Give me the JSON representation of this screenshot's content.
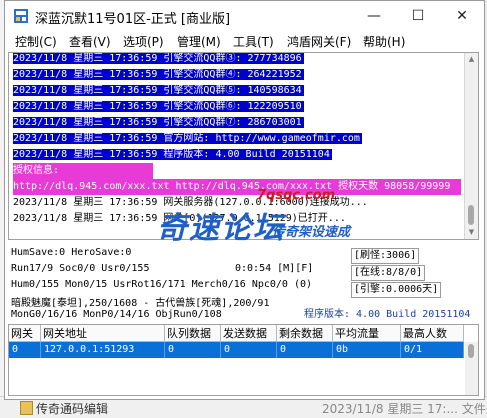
{
  "window": {
    "title": "深蓝沉默11号01区-正式 [商业版]",
    "minimize": "—",
    "maximize": "☐",
    "close": "✕"
  },
  "menu": [
    {
      "label": "控制(C)"
    },
    {
      "label": "查看(V)"
    },
    {
      "label": "选项(P)"
    },
    {
      "label": "管理(M)"
    },
    {
      "label": "工具(T)"
    },
    {
      "label": "鸿盾网关(F)"
    },
    {
      "label": "帮助(H)"
    }
  ],
  "log": {
    "selected_lines": [
      "2023/11/8 星期三 17:36:59 引擎交流QQ群③: 277734896",
      "2023/11/8 星期三 17:36:59 引擎交流QQ群④: 264221952",
      "2023/11/8 星期三 17:36:59 引擎交流QQ群⑤: 140598634",
      "2023/11/8 星期三 17:36:59 引擎交流QQ群⑥: 122209510",
      "2023/11/8 星期三 17:36:59 引擎交流QQ群⑦: 286703001",
      "2023/11/8 星期三 17:36:59 官方网站: http://www.gameofmir.com",
      "2023/11/8 星期三 17:36:59 程序版本: 4.00 Build 20151104"
    ],
    "auth_label": "授权信息:",
    "auth_line": "http://dlq.945.com/xxx.txt http://dlq.945.com/xxx.txt 授权天数 98058/99999",
    "normal_lines": [
      "2023/11/8 星期三 17:36:59 网关服务器(127.0.0.1:6000)连接成功...",
      "2023/11/8 星期三 17:36:59 网关[0](127.0.0.1:5129)已打开..."
    ]
  },
  "watermark": {
    "main": "奇速论坛",
    "url": "7qsqc.com",
    "sub": "传奇架设速成"
  },
  "status": {
    "line1": "HumSave:0 HeroSave:0",
    "line2": "Run17/9 Soc0/0 Usr0/155",
    "timer": "0:0:54 [M][F]",
    "line3": "Hum0/155 Mon0/15 UsrRot16/171 Merch0/16 Npc0/0 (0)",
    "line4": "暗殿魅魔[泰坦],250/1608 - 古代兽族[死魂],200/91",
    "line5": "MonG0/16/16 MonP0/14/16 ObjRun0/108",
    "refresh": "[刷怪:3006]",
    "online": "[在线:8/8/0]",
    "engine": "[引擎:0.0006天]",
    "version": "程序版本: 4.00 Build 20151104"
  },
  "gateway_table": {
    "headers": [
      "网关",
      "网关地址",
      "队列数据",
      "发送数据",
      "剩余数据",
      "平均流量",
      "最高人数"
    ],
    "rows": [
      [
        "0",
        "127.0.0.1:51293",
        "0",
        "0",
        "0",
        "0b",
        "0/1"
      ]
    ]
  },
  "background": {
    "taskbar_item": "传奇通码编辑",
    "taskbar_right": "2023/11/8 星期三 17:... 文件夹"
  },
  "colors": {
    "selection": "#0000cc",
    "auth_highlight": "#e83ad6",
    "row_selected": "#0a6fd6",
    "version_text": "#1a3fa8"
  }
}
